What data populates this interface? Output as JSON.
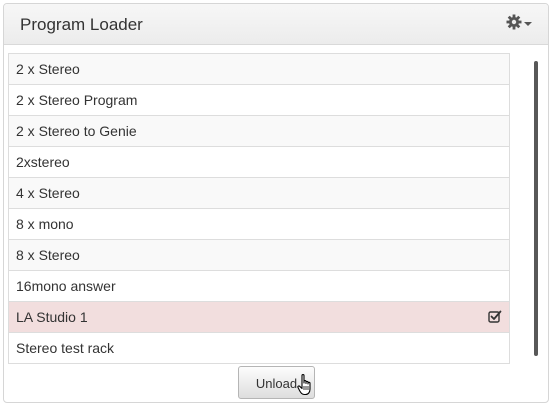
{
  "panel": {
    "title": "Program Loader",
    "settings_icon": "gear-icon"
  },
  "programs": [
    {
      "label": "2 x Stereo",
      "selected": false
    },
    {
      "label": "2 x Stereo Program",
      "selected": false
    },
    {
      "label": "2 x Stereo to Genie",
      "selected": false
    },
    {
      "label": "2xstereo",
      "selected": false
    },
    {
      "label": "4 x Stereo",
      "selected": false
    },
    {
      "label": "8 x mono",
      "selected": false
    },
    {
      "label": "8 x Stereo",
      "selected": false
    },
    {
      "label": "16mono answer",
      "selected": false
    },
    {
      "label": "LA Studio 1",
      "selected": true
    },
    {
      "label": "Stereo test rack",
      "selected": false
    }
  ],
  "actions": {
    "unload_label": "Unload"
  },
  "colors": {
    "selected_row": "#f2dede",
    "striped_row": "#f9f9f9"
  }
}
